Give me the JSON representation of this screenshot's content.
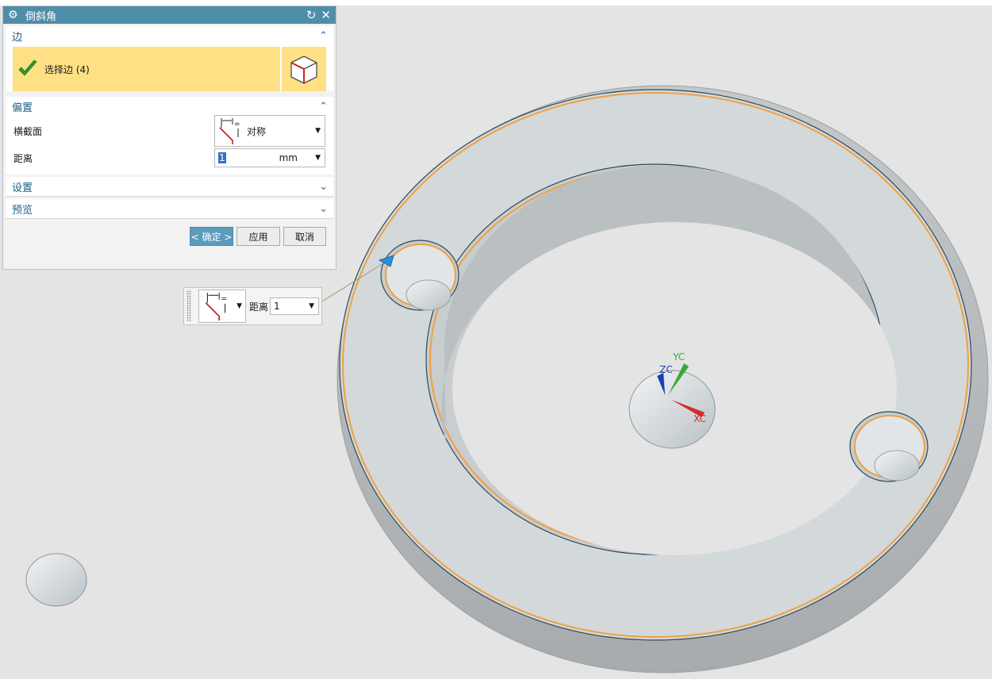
{
  "dialog": {
    "title": "倒斜角",
    "title_icon": "gear-icon",
    "buttons": {
      "reset": "reset-icon",
      "close": "close-icon"
    },
    "sections": {
      "edge": {
        "label": "边",
        "expanded": true,
        "selection_label": "选择边 (4)"
      },
      "offset": {
        "label": "偏置",
        "expanded": true,
        "cross_section_label": "横截面",
        "cross_section_value": "对称",
        "distance_label": "距离",
        "distance_value": "1",
        "distance_unit": "mm"
      },
      "settings": {
        "label": "设置",
        "expanded": false
      },
      "preview": {
        "label": "预览",
        "expanded": false
      }
    },
    "actions": {
      "ok": "< 确定 >",
      "apply": "应用",
      "cancel": "取消"
    }
  },
  "floating_toolbar": {
    "distance_label": "距离",
    "distance_value": "1"
  },
  "csys": {
    "x_label": "XC",
    "y_label": "YC",
    "z_label": "ZC"
  },
  "colors": {
    "title_bar": "#4f8ea8",
    "section_header_text": "#1b6189",
    "selection_highlight": "#ffe084",
    "primary_button": "#5b9cbd",
    "viewport_background": "#e3e4e3",
    "selected_edge": "#f0a040",
    "model_face": "#d4d8da",
    "axis_x": "#d42a2a",
    "axis_y": "#3aa83a",
    "axis_z": "#1f3fae"
  }
}
